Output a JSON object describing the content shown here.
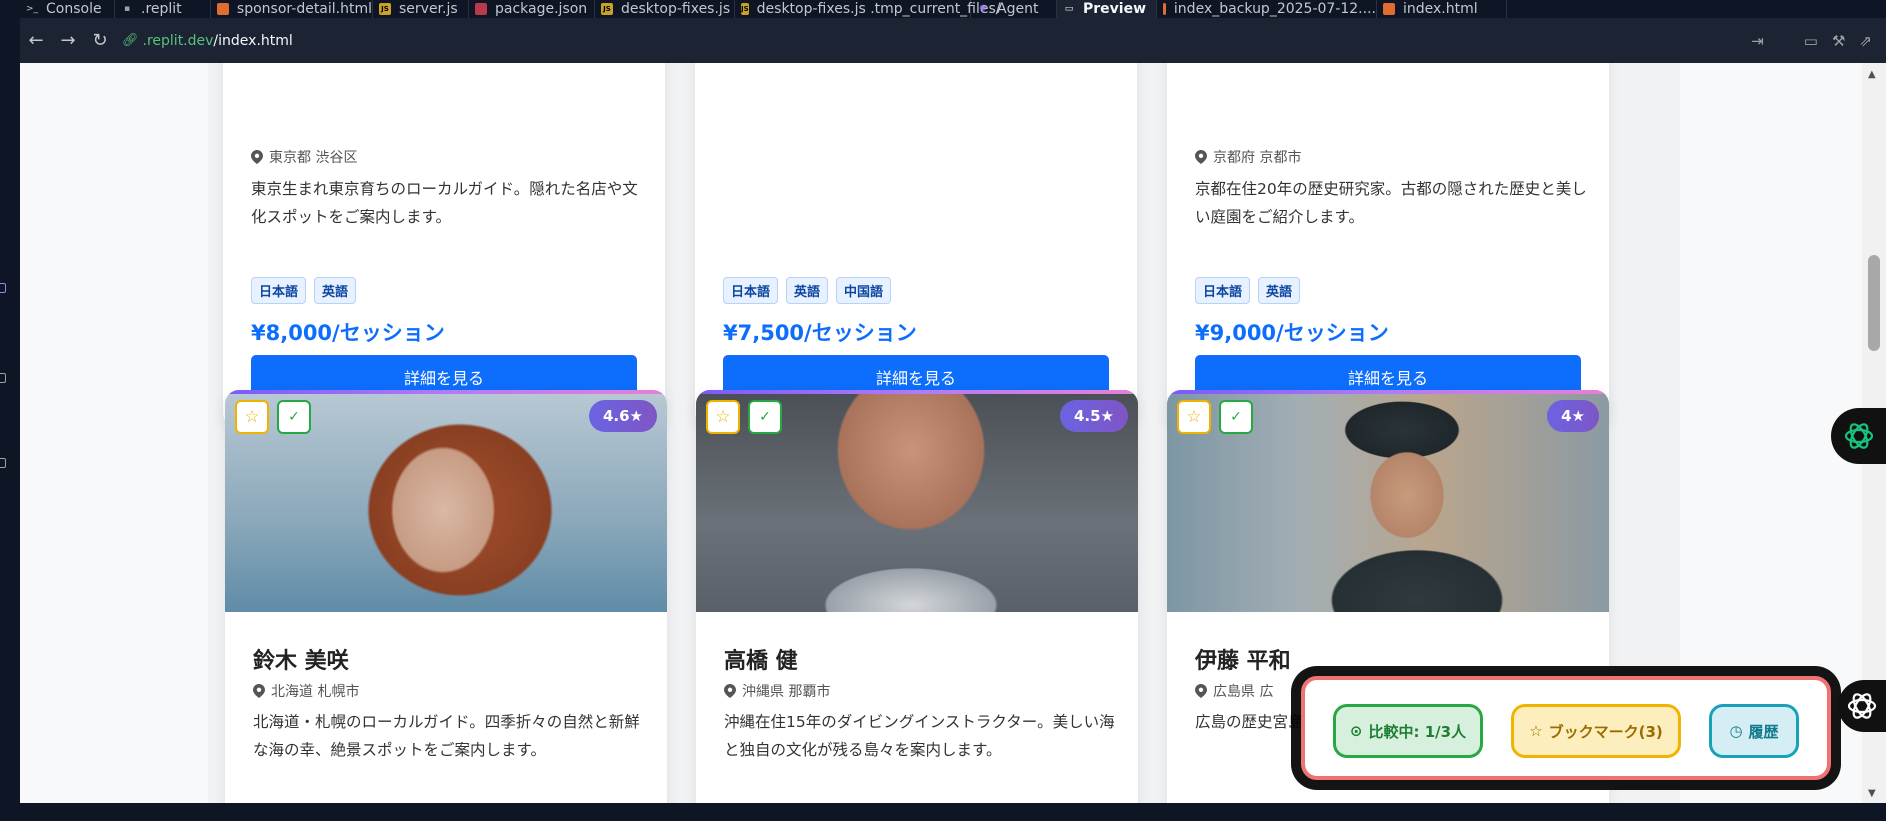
{
  "tabs": [
    {
      "label": "Console",
      "icon": "terminal-icon"
    },
    {
      "label": ".replit",
      "icon": "replit-icon"
    },
    {
      "label": "sponsor-detail.html",
      "icon": "html-file-icon"
    },
    {
      "label": "server.js",
      "icon": "js-file-icon"
    },
    {
      "label": "package.json",
      "icon": "json-file-icon"
    },
    {
      "label": "desktop-fixes.js",
      "icon": "js-file-icon"
    },
    {
      "label": "desktop-fixes.js .tmp_current_files/",
      "icon": "js-file-icon"
    },
    {
      "label": "Agent",
      "icon": "agent-icon"
    },
    {
      "label": "Preview",
      "icon": "preview-icon"
    },
    {
      "label": "index_backup_2025-07-12....",
      "icon": "html-file-icon"
    },
    {
      "label": "index.html",
      "icon": "html-file-icon"
    }
  ],
  "address": {
    "host": ".replit.dev",
    "path": "/index.html"
  },
  "top_cards": [
    {
      "location": "東京都 渋谷区",
      "description": "東京生まれ東京育ちのローカルガイド。隠れた名店や文化スポットをご案内します。",
      "tags": [
        "日本語",
        "英語"
      ],
      "price": "¥8,000/セッション",
      "button": "詳細を見る"
    },
    {
      "location": "",
      "description": "",
      "tags": [
        "日本語",
        "英語",
        "中国語"
      ],
      "price": "¥7,500/セッション",
      "button": "詳細を見る"
    },
    {
      "location": "京都府 京都市",
      "description": "京都在住20年の歴史研究家。古都の隠された歴史と美しい庭園をご紹介します。",
      "tags": [
        "日本語",
        "英語"
      ],
      "price": "¥9,000/セッション",
      "button": "詳細を見る"
    }
  ],
  "bottom_cards": [
    {
      "name": "鈴木 美咲",
      "location": "北海道 札幌市",
      "description": "北海道・札幌のローカルガイド。四季折々の自然と新鮮な海の幸、絶景スポットをご案内します。",
      "rating": "4.6★"
    },
    {
      "name": "高橋 健",
      "location": "沖縄県 那覇市",
      "description": "沖縄在住15年のダイビングインストラクター。美しい海と独自の文化が残る島々を案内します。",
      "rating": "4.5★"
    },
    {
      "name": "伊藤 平和",
      "location": "広島県 広",
      "description": "広島の歴史宮島まで、",
      "rating": "4★"
    }
  ],
  "floatbar": {
    "compare": "比較中: 1/3人",
    "bookmark": "ブックマーク(3)",
    "history": "履歴"
  },
  "colors": {
    "primary": "#0d6efd",
    "success": "#28a745",
    "warning": "#f0b400",
    "info": "#17a2b8",
    "highlight": "#f07272"
  }
}
